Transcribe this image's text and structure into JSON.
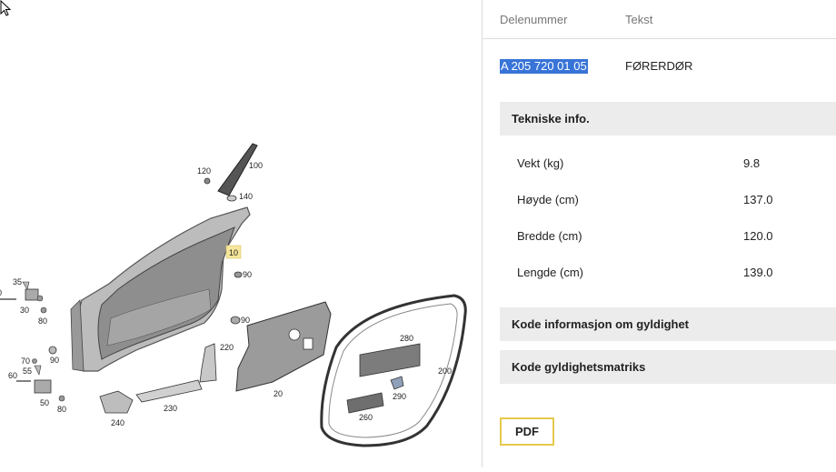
{
  "diagram": {
    "callouts": {
      "c100": "100",
      "c120": "120",
      "c140": "140",
      "c10": "10",
      "c90a": "90",
      "c90b": "90",
      "c90c": "90",
      "c35": "35",
      "c30": "30",
      "c80a": "80",
      "c50_top": "50",
      "c70": "70",
      "c55": "55",
      "c60": "60",
      "c50": "50",
      "c80b": "80",
      "c220": "220",
      "c20": "20",
      "c230": "230",
      "c240": "240",
      "c280": "280",
      "c200": "200",
      "c290": "290",
      "c260": "260"
    },
    "highlight_color": "#f5e69a"
  },
  "table": {
    "col_part": "Delenummer",
    "col_text": "Tekst",
    "part_number": "A 205 720 01 05",
    "part_name": "FØRERDØR",
    "selection_color": "#3874d8"
  },
  "tech": {
    "title": "Tekniske info.",
    "rows": [
      {
        "label": "Vekt (kg)",
        "value": "9.8"
      },
      {
        "label": "Høyde (cm)",
        "value": "137.0"
      },
      {
        "label": "Bredde (cm)",
        "value": "120.0"
      },
      {
        "label": "Lengde (cm)",
        "value": "139.0"
      }
    ]
  },
  "sections": {
    "validity_info": "Kode informasjon om gyldighet",
    "validity_matrix": "Kode gyldighetsmatriks"
  },
  "pdf_label": "PDF",
  "pdf_border_color": "#e6c94a"
}
